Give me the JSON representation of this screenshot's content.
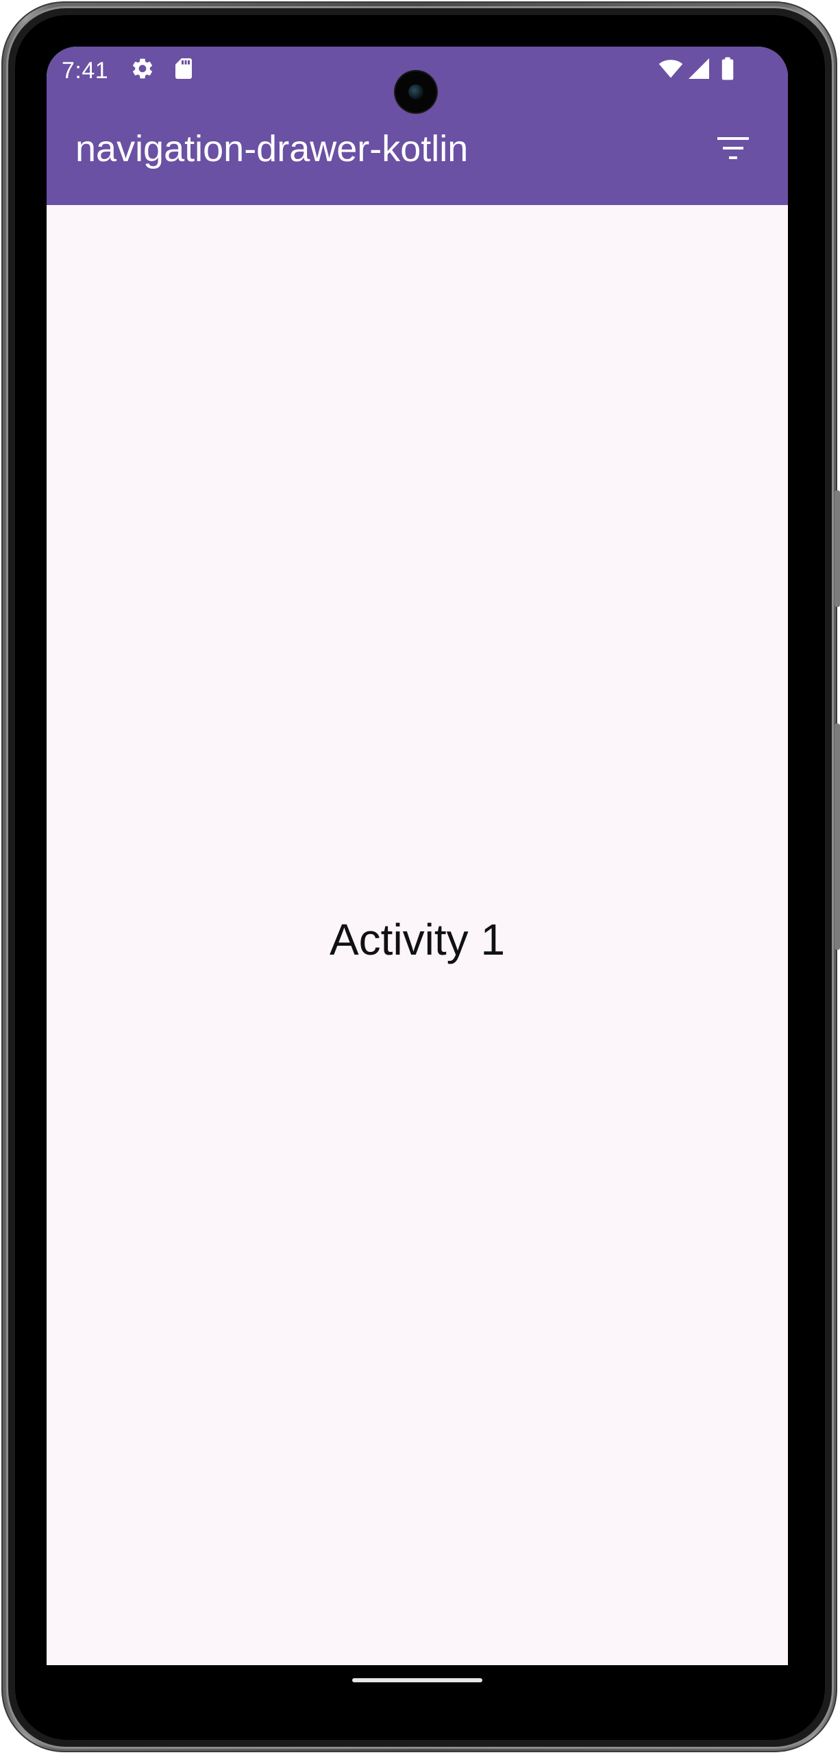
{
  "status_bar": {
    "time": "7:41",
    "left_icons": [
      "gear-icon",
      "sd-card-icon"
    ],
    "right_icons": [
      "wifi-icon",
      "cellular-signal-icon",
      "battery-icon"
    ]
  },
  "app_bar": {
    "title": "navigation-drawer-kotlin",
    "action_icon": "filter-icon",
    "color": "#6a51a3"
  },
  "content": {
    "label": "Activity 1",
    "background": "#fcf6fb"
  }
}
